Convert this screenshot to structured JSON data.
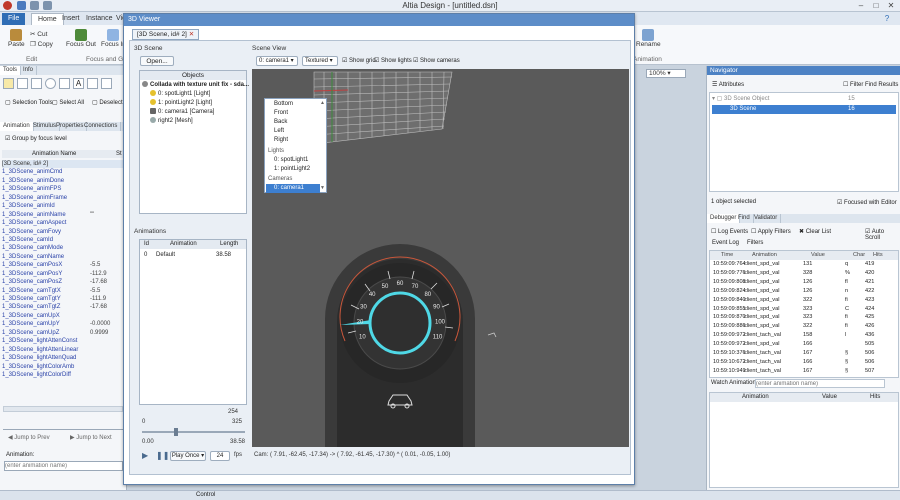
{
  "app": {
    "title": "Altia Design - [untitled.dsn]"
  },
  "ribbon": {
    "tabs": [
      "File",
      "Home",
      "Insert",
      "Instance",
      "View"
    ],
    "paste": "Paste",
    "cut": "Cut",
    "copy": "Copy",
    "focus_out": "Focus Out",
    "focus_in": "Focus In",
    "group_edit": "Edit",
    "group_focus": "Focus and G",
    "rename": "Rename",
    "group_animation": "Animation",
    "zoom": "100%"
  },
  "left": {
    "tabs1": [
      "Tools",
      "Info"
    ],
    "selection_tools": "Selection Tools",
    "select_all": "Select All",
    "deselect": "Deselect",
    "tabs2": [
      "Animation",
      "Stimulus",
      "Properties",
      "Connections"
    ],
    "group_by_focus": "Group by focus level",
    "col_name": "Animation Name",
    "col_state": "St",
    "rows": [
      "[3D Scene, id# 2]",
      "1_3DScene_animCmd",
      "1_3DScene_animDone",
      "1_3DScene_animFPS",
      "1_3DScene_animFrame",
      "1_3DScene_animId",
      "1_3DScene_animName",
      "1_3DScene_camAspect",
      "1_3DScene_camFovy",
      "1_3DScene_camId",
      "1_3DScene_camMode",
      "1_3DScene_camName",
      "1_3DScene_camPosX",
      "1_3DScene_camPosY",
      "1_3DScene_camPosZ",
      "1_3DScene_camTgtX",
      "1_3DScene_camTgtY",
      "1_3DScene_camTgtZ",
      "1_3DScene_camUpX",
      "1_3DScene_camUpY",
      "1_3DScene_camUpZ",
      "1_3DScene_lightAttenConst",
      "1_3DScene_lightAttenLinear",
      "1_3DScene_lightAttenQuad",
      "1_3DScene_lightColorAmb",
      "1_3DScene_lightColorDiff"
    ],
    "values": [
      "",
      "",
      "",
      "",
      "",
      "",
      "\"\"",
      "",
      "",
      "",
      "",
      "",
      "-5.5",
      "-112.9",
      "-17.68",
      "-5.5",
      "-111.9",
      "-17.68",
      "",
      "-0.0000",
      "0.9999",
      "",
      "",
      "",
      "",
      ""
    ],
    "jump_prev": "Jump to Prev",
    "jump_next": "Jump to Next",
    "animation_label": "Animation:",
    "animation_placeholder": "(enter animation name)"
  },
  "dialog": {
    "title": "3D Viewer",
    "tab": "[3D Scene, id# 2]",
    "scene_label": "3D Scene",
    "open": "Open...",
    "objects_header": "Objects",
    "objects": [
      "Collada with texture unit fix - sda...",
      "0: spotLight1 [Light]",
      "1: pointLight2 [Light]",
      "0: camera1 [Camera]",
      "right2 [Mesh]"
    ],
    "animations_label": "Animations",
    "anim_cols": [
      "Id",
      "Animation",
      "Length"
    ],
    "anim_row": [
      "0",
      "Default",
      "38.58"
    ],
    "slider_max": "254",
    "slider_val": "325",
    "slider_min": "0",
    "time_start": "0.00",
    "time_end": "38.58",
    "play_once": "Play Once",
    "fps": "24",
    "fps_label": "fps",
    "scene_view": "Scene View",
    "camera_select": "0: camera1",
    "mode_select": "Textured",
    "show_grid": "Show grid",
    "show_lights": "Show lights",
    "show_cameras": "Show cameras",
    "dropdown": {
      "views": [
        "Bottom",
        "Front",
        "Back",
        "Left",
        "Right"
      ],
      "lights_header": "Lights",
      "lights": [
        "0: spotLight1",
        "1: pointLight2"
      ],
      "cameras_header": "Cameras",
      "cameras": [
        "0: camera1"
      ]
    },
    "cam_status": "Cam: ( 7.91, -62.45, -17.34) -> ( 7.92, -61.45, -17.30) ^ ( 0.01, -0.05, 1.00)",
    "gauge_labels": [
      "10",
      "20",
      "30",
      "40",
      "50",
      "60",
      "70",
      "80",
      "90",
      "100",
      "110"
    ]
  },
  "right": {
    "navigator": "Navigator",
    "attributes": "Attributes",
    "filter_find": "Filter Find Results",
    "tree": [
      "3D Scene Object",
      "3D Scene"
    ],
    "tree_ids": [
      "15",
      "16"
    ],
    "selected_count": "1 object selected",
    "focused_editor": "Focused with Editor",
    "debug_tabs": [
      "Debugger",
      "Find",
      "Validator"
    ],
    "log_events": "Log Events",
    "apply_filters": "Apply Filters",
    "clear_list": "Clear List",
    "auto_scroll": "Auto Scroll",
    "event_tabs": [
      "Event Log",
      "Filters"
    ],
    "cols": [
      "Time",
      "Animation",
      "Value",
      "Char",
      "Hits"
    ],
    "rows": [
      [
        "10:59:09:764",
        "client_spd_val",
        "131",
        "q",
        "419"
      ],
      [
        "10:59:09:776",
        "client_spd_val",
        "328",
        "%",
        "420"
      ],
      [
        "10:59:09:808",
        "client_spd_val",
        "126",
        "fl",
        "421"
      ],
      [
        "10:59:09:824",
        "client_spd_val",
        "126",
        "n",
        "422"
      ],
      [
        "10:59:09:840",
        "client_spd_val",
        "322",
        "fi",
        "423"
      ],
      [
        "10:59:09:855",
        "client_spd_val",
        "323",
        "C",
        "424"
      ],
      [
        "10:59:09:870",
        "client_spd_val",
        "323",
        "fi",
        "425"
      ],
      [
        "10:59:09:886",
        "client_spd_val",
        "322",
        "fi",
        "426"
      ],
      [
        "10:59:09:972",
        "client_tach_val",
        "158",
        "l",
        "436"
      ],
      [
        "10:59:09:972",
        "client_spd_val",
        "166",
        "",
        "505"
      ],
      [
        "10:59:10:376",
        "client_tach_val",
        "167",
        "§",
        "506"
      ],
      [
        "10:59:10:672",
        "client_tach_val",
        "166",
        "§",
        "506"
      ],
      [
        "10:59:10:949",
        "client_tach_val",
        "167",
        "§",
        "507"
      ]
    ],
    "watch_label": "Watch Animation:",
    "watch_placeholder": "(enter animation name)",
    "watch_cols": [
      "Animation",
      "Value",
      "Hits"
    ]
  },
  "status": {
    "text": "Control"
  },
  "colors": {
    "accent": "#2f6db5",
    "gauge_ring": "#4fd8e6",
    "gauge_needle": "#4fd8e6",
    "viewport": "#5a5a5a",
    "selection": "#3d7fd0"
  }
}
